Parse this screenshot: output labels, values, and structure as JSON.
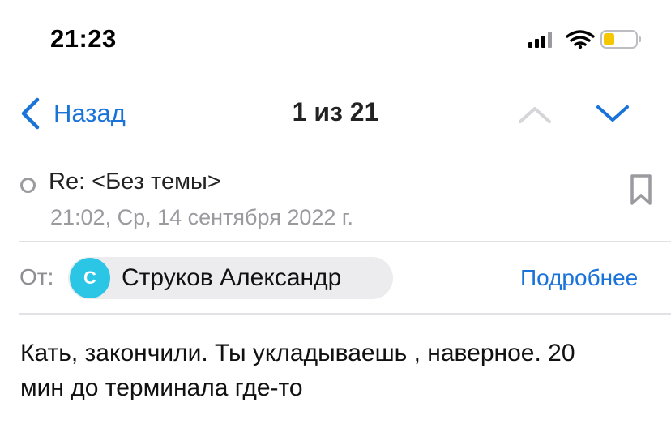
{
  "status_bar": {
    "time": "21:23",
    "icons": [
      "cellular-signal-icon",
      "wifi-icon",
      "battery-low-icon"
    ],
    "battery_color": "#f5c700"
  },
  "nav": {
    "back_label": "Назад",
    "counter": "1 из 21",
    "prev_enabled": false,
    "next_enabled": true,
    "accent_color": "#1a73d9"
  },
  "message": {
    "subject": "Re: <Без темы>",
    "timestamp": "21:02, Ср, 14 сентября 2022 г.",
    "from_label": "От:",
    "sender": {
      "initial": "С",
      "name": "Струков Александр",
      "avatar_color": "#2bc6e6"
    },
    "details_label": "Подробнее",
    "body_lines": [
      "Кать, закончили. Ты укладываешь , наверное. 20",
      "мин до терминала где-то"
    ]
  }
}
